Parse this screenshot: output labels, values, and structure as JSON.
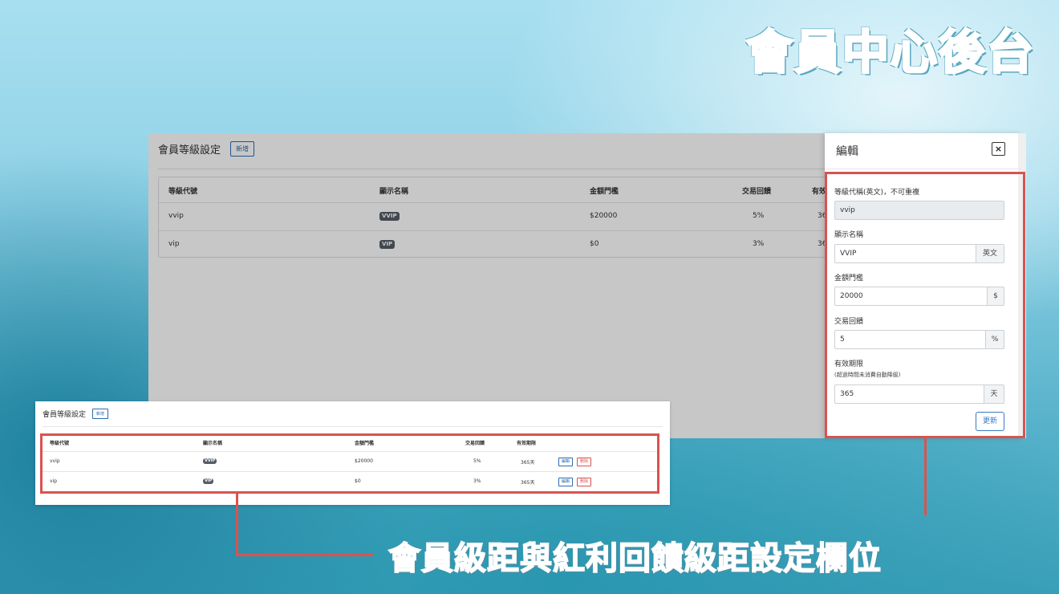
{
  "hero_title": "會員中心後台",
  "caption": "會員級距與紅利回饋級距設定欄位",
  "page": {
    "title": "會員等級設定",
    "add_button": "新增",
    "columns": [
      "等級代號",
      "顯示名稱",
      "金額門檻",
      "交易回饋",
      "有效期限"
    ],
    "rows": [
      {
        "code": "vvip",
        "name": "VVIP",
        "threshold": "$20000",
        "rebate": "5%",
        "validity": "365天"
      },
      {
        "code": "vip",
        "name": "VIP",
        "threshold": "$0",
        "rebate": "3%",
        "validity": "365天"
      }
    ],
    "bg_partial": {
      "col5_header": "有效",
      "row1_validity": "36",
      "row2_validity": "36"
    },
    "edit_button": "編輯",
    "delete_button": "刪除"
  },
  "modal": {
    "title": "編輯",
    "close_icon": "×",
    "fields": {
      "code_label": "等級代稱(英文)，不可重複",
      "code_value": "vvip",
      "name_label": "顯示名稱",
      "name_value": "VVIP",
      "name_addon": "英文",
      "threshold_label": "金額門檻",
      "threshold_value": "20000",
      "threshold_addon": "$",
      "rebate_label": "交易回饋",
      "rebate_value": "5",
      "rebate_addon": "%",
      "validity_label": "有效期限",
      "validity_hint": "(超過時間未消費自動降級)",
      "validity_value": "365",
      "validity_addon": "天"
    },
    "update_button": "更新"
  },
  "colors": {
    "highlight": "#d9534f",
    "primary": "#2b6cb0",
    "badge": "#555d66"
  }
}
